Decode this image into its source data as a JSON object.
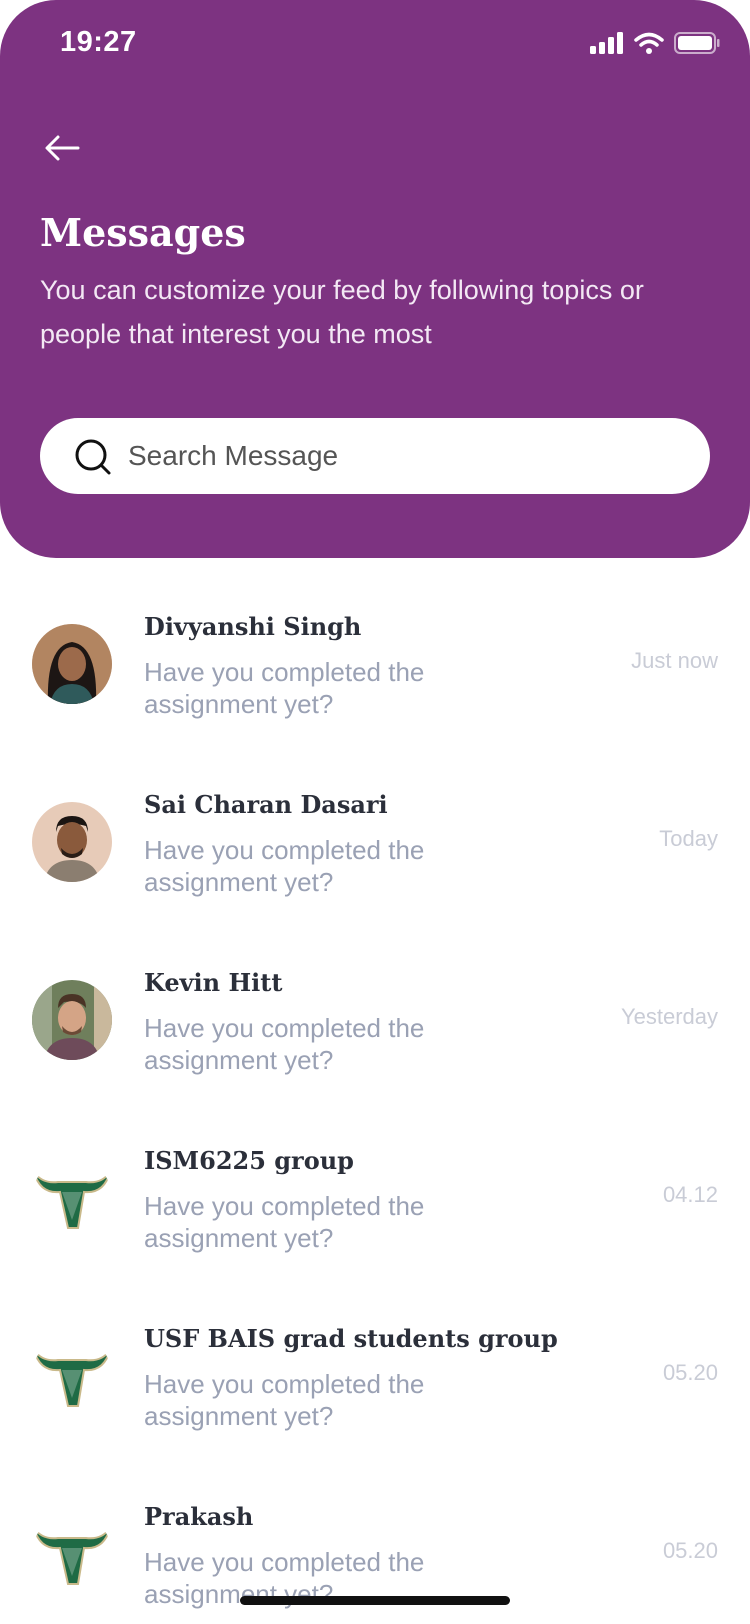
{
  "status_bar": {
    "time": "19:27",
    "icons": [
      "signal-icon",
      "wifi-icon",
      "battery-icon"
    ]
  },
  "header": {
    "back_icon": "arrow-left-icon",
    "title": "Messages",
    "subtitle": "You can customize your feed by following topics or people that interest you the most",
    "background_color": "#7D3381"
  },
  "search": {
    "placeholder": "Search Message",
    "value": "",
    "icon": "search-icon"
  },
  "conversations": [
    {
      "name": "Divyanshi Singh",
      "preview": "Have you completed the assignment yet?",
      "time": "Just now",
      "avatar": "person-photo"
    },
    {
      "name": "Sai Charan Dasari",
      "preview": "Have you completed the assignment yet?",
      "time": "Today",
      "avatar": "person-photo"
    },
    {
      "name": "Kevin Hitt",
      "preview": "Have you completed the assignment yet?",
      "time": "Yesterday",
      "avatar": "person-photo"
    },
    {
      "name": "ISM6225 group",
      "preview": "Have you completed the assignment yet?",
      "time": "04.12",
      "avatar": "usf-bull-logo"
    },
    {
      "name": "USF BAIS grad students group",
      "preview": "Have you completed the assignment yet?",
      "time": "05.20",
      "avatar": "usf-bull-logo"
    },
    {
      "name": "Prakash",
      "preview": "Have you completed the assignment yet?",
      "time": "05.20",
      "avatar": "usf-bull-logo"
    }
  ]
}
